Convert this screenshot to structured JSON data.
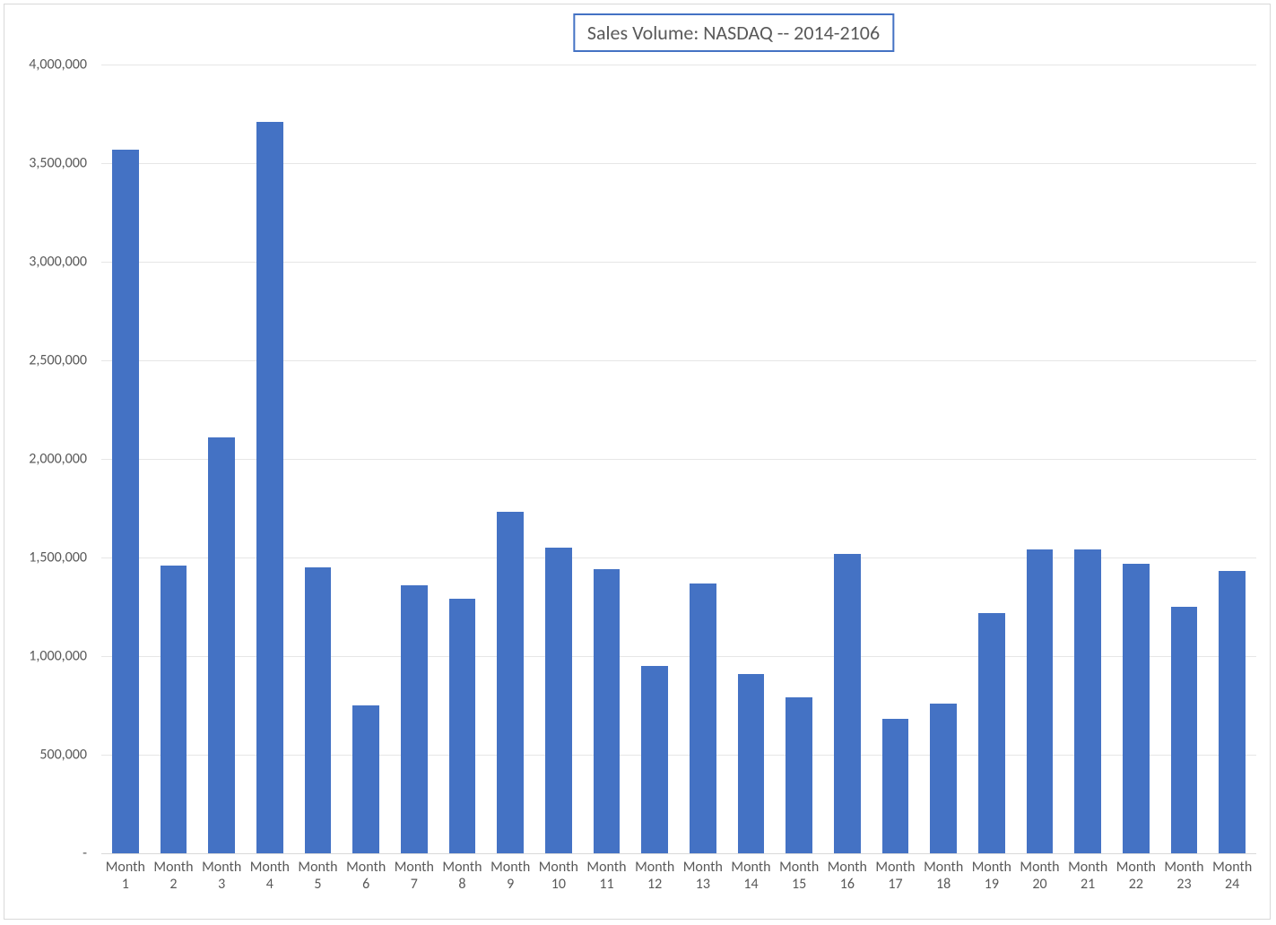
{
  "chart_data": {
    "type": "bar",
    "title": "Sales Volume: NASDAQ -- 2014-2106",
    "categories": [
      "Month 1",
      "Month 2",
      "Month 3",
      "Month 4",
      "Month 5",
      "Month 6",
      "Month 7",
      "Month 8",
      "Month 9",
      "Month 10",
      "Month 11",
      "Month 12",
      "Month 13",
      "Month 14",
      "Month 15",
      "Month 16",
      "Month 17",
      "Month 18",
      "Month 19",
      "Month 20",
      "Month 21",
      "Month 22",
      "Month 23",
      "Month 24"
    ],
    "values": [
      3570000,
      1460000,
      2110000,
      3710000,
      1450000,
      750000,
      1360000,
      1290000,
      1730000,
      1550000,
      1440000,
      950000,
      1370000,
      910000,
      790000,
      1520000,
      680000,
      760000,
      1220000,
      1540000,
      1540000,
      1470000,
      1250000,
      1430000
    ],
    "xlabel": "",
    "ylabel": "",
    "ylim": [
      0,
      4000000
    ],
    "y_ticks": [
      0,
      500000,
      1000000,
      1500000,
      2000000,
      2500000,
      3000000,
      3500000,
      4000000
    ],
    "y_tick_labels": [
      " -",
      " 500,000",
      " 1,000,000",
      " 1,500,000",
      " 2,000,000",
      " 2,500,000",
      " 3,000,000",
      " 3,500,000",
      " 4,000,000"
    ],
    "bar_color": "#4472c4"
  }
}
